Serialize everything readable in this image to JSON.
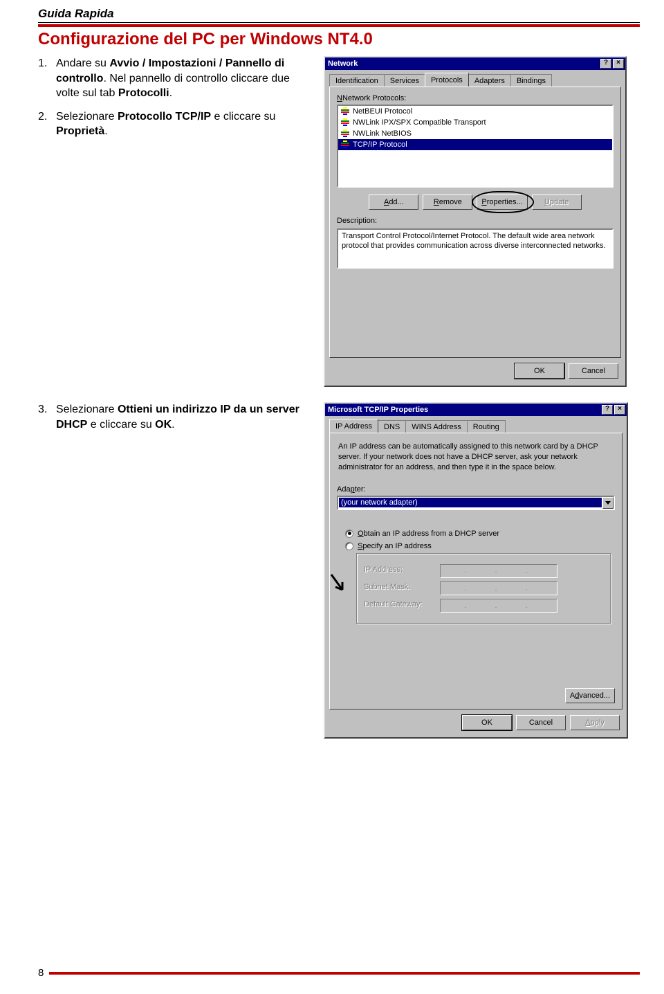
{
  "page": {
    "header": "Guida Rapida",
    "title": "Configurazione del PC per Windows NT4.0",
    "number": "8"
  },
  "steps": {
    "s1": {
      "num": "1.",
      "pre": "Andare su ",
      "b1": "Avvio / Impostazioni / Pannello di controllo",
      "mid": ". Nel pannello di controllo cliccare due volte sul tab ",
      "b2": "Protocolli",
      "post": "."
    },
    "s2": {
      "num": "2.",
      "pre": "Selezionare ",
      "b1": "Protocollo TCP/IP",
      "mid": " e cliccare su ",
      "b2": "Proprietà",
      "post": "."
    },
    "s3": {
      "num": "3.",
      "pre": "Selezionare ",
      "b1": "Ottieni un indirizzo IP da un server DHCP",
      "mid": " e cliccare su ",
      "b2": "OK",
      "post": "."
    }
  },
  "dlg1": {
    "title": "Network",
    "help": "?",
    "close": "×",
    "tabs": {
      "t1": "Identification",
      "t2": "Services",
      "t3": "Protocols",
      "t4": "Adapters",
      "t5": "Bindings"
    },
    "list_label": "Network Protocols:",
    "items": {
      "i1": "NetBEUI Protocol",
      "i2": "NWLink IPX/SPX Compatible Transport",
      "i3": "NWLink NetBIOS",
      "i4": "TCP/IP Protocol"
    },
    "btns": {
      "add": "Add...",
      "remove": "Remove",
      "properties": "Properties...",
      "update": "Update"
    },
    "desc_label": "Description:",
    "desc": "Transport Control Protocol/Internet Protocol. The default wide area network protocol that provides communication across diverse interconnected networks.",
    "ok": "OK",
    "cancel": "Cancel"
  },
  "dlg2": {
    "title": "Microsoft TCP/IP Properties",
    "help": "?",
    "close": "×",
    "tabs": {
      "t1": "IP Address",
      "t2": "DNS",
      "t3": "WINS Address",
      "t4": "Routing"
    },
    "help_text": "An IP address can be automatically assigned to this network card by a DHCP server. If your network does not have a DHCP server, ask your network administrator for an address, and then type it in the space below.",
    "adapter_label": "Adapter:",
    "adapter_value": "(your network adapter)",
    "radio1": "Obtain an IP address from a DHCP server",
    "radio2_pre": "Specify an IP address",
    "group": {
      "ip": "IP Address:",
      "mask": "Subnet Mask:",
      "gw": "Default Gateway:"
    },
    "dots": ".     .     .",
    "advanced": "Advanced...",
    "ok": "OK",
    "cancel": "Cancel",
    "apply": "Apply"
  }
}
